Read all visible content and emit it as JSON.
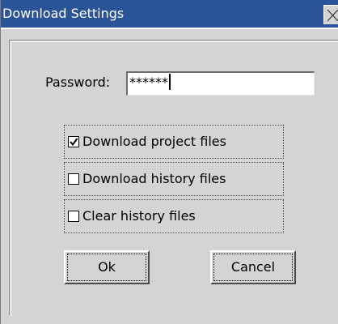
{
  "window": {
    "title": "Download Settings",
    "close_icon": "close-icon",
    "title_bar_color": "#2b5397"
  },
  "password": {
    "label": "Password:",
    "masked_value": "******"
  },
  "options": [
    {
      "label": "Download project files",
      "checked": true
    },
    {
      "label": "Download history files",
      "checked": false
    },
    {
      "label": "Clear history files",
      "checked": false
    }
  ],
  "buttons": {
    "ok_label": "Ok",
    "cancel_label": "Cancel"
  }
}
